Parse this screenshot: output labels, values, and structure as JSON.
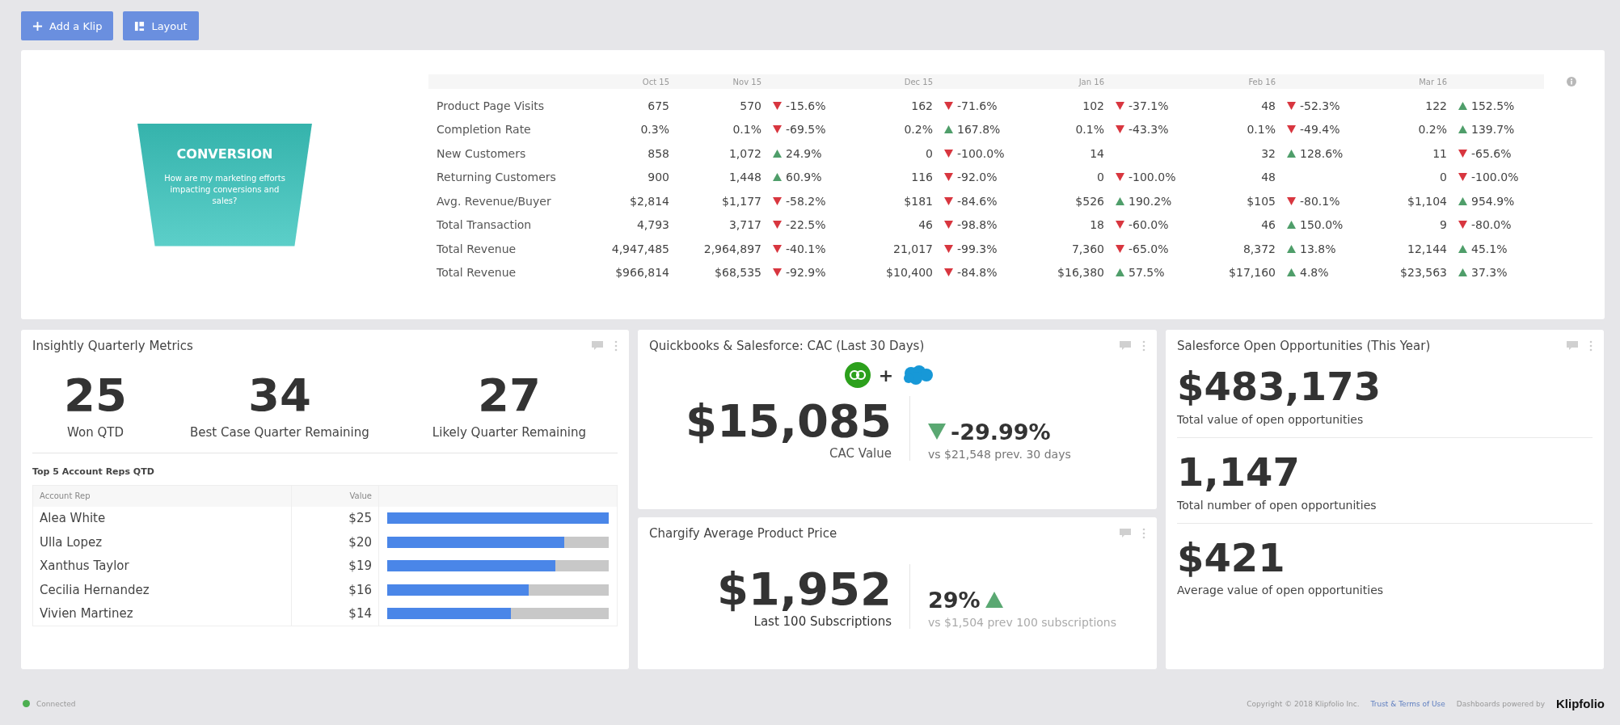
{
  "toolbar": {
    "buttons": [
      {
        "kind": "add",
        "label": "Add a Klip"
      },
      {
        "kind": "layout",
        "label": "Layout"
      }
    ]
  },
  "conversion": {
    "title": "CONVERSION",
    "description": "How are my marketing efforts impacting conversions and sales?"
  },
  "metrics_table": {
    "columns": [
      "Oct 15",
      "Nov 15",
      "Dec 15",
      "Jan 16",
      "Feb 16",
      "Mar 16"
    ],
    "rows": [
      {
        "label": "Product Page Visits",
        "cells": [
          {
            "value": "675"
          },
          {
            "value": "570",
            "change": "-15.6%",
            "up": false
          },
          {
            "value": "162",
            "change": "-71.6%",
            "up": false
          },
          {
            "value": "102",
            "change": "-37.1%",
            "up": false
          },
          {
            "value": "48",
            "change": "-52.3%",
            "up": false
          },
          {
            "value": "122",
            "change": "152.5%",
            "up": true
          }
        ]
      },
      {
        "label": "Completion Rate",
        "cells": [
          {
            "value": "0.3%"
          },
          {
            "value": "0.1%",
            "change": "-69.5%",
            "up": false
          },
          {
            "value": "0.2%",
            "change": "167.8%",
            "up": true
          },
          {
            "value": "0.1%",
            "change": "-43.3%",
            "up": false
          },
          {
            "value": "0.1%",
            "change": "-49.4%",
            "up": false
          },
          {
            "value": "0.2%",
            "change": "139.7%",
            "up": true
          }
        ]
      },
      {
        "label": "New Customers",
        "cells": [
          {
            "value": "858"
          },
          {
            "value": "1,072",
            "change": "24.9%",
            "up": true
          },
          {
            "value": "0",
            "change": "-100.0%",
            "up": false
          },
          {
            "value": "14"
          },
          {
            "value": "32",
            "change": "128.6%",
            "up": true
          },
          {
            "value": "11",
            "change": "-65.6%",
            "up": false
          }
        ]
      },
      {
        "label": "Returning Customers",
        "cells": [
          {
            "value": "900"
          },
          {
            "value": "1,448",
            "change": "60.9%",
            "up": true
          },
          {
            "value": "116",
            "change": "-92.0%",
            "up": false
          },
          {
            "value": "0",
            "change": "-100.0%",
            "up": false
          },
          {
            "value": "48"
          },
          {
            "value": "0",
            "change": "-100.0%",
            "up": false
          }
        ]
      },
      {
        "label": "Avg. Revenue/Buyer",
        "cells": [
          {
            "value": "$2,814"
          },
          {
            "value": "$1,177",
            "change": "-58.2%",
            "up": false
          },
          {
            "value": "$181",
            "change": "-84.6%",
            "up": false
          },
          {
            "value": "$526",
            "change": "190.2%",
            "up": true
          },
          {
            "value": "$105",
            "change": "-80.1%",
            "up": false
          },
          {
            "value": "$1,104",
            "change": "954.9%",
            "up": true
          }
        ]
      },
      {
        "label": "Total Transaction",
        "cells": [
          {
            "value": "4,793"
          },
          {
            "value": "3,717",
            "change": "-22.5%",
            "up": false
          },
          {
            "value": "46",
            "change": "-98.8%",
            "up": false
          },
          {
            "value": "18",
            "change": "-60.0%",
            "up": false
          },
          {
            "value": "46",
            "change": "150.0%",
            "up": true
          },
          {
            "value": "9",
            "change": "-80.0%",
            "up": false
          }
        ]
      },
      {
        "label": "Total Revenue",
        "cells": [
          {
            "value": "4,947,485"
          },
          {
            "value": "2,964,897",
            "change": "-40.1%",
            "up": false
          },
          {
            "value": "21,017",
            "change": "-99.3%",
            "up": false
          },
          {
            "value": "7,360",
            "change": "-65.0%",
            "up": false
          },
          {
            "value": "8,372",
            "change": "13.8%",
            "up": true
          },
          {
            "value": "12,144",
            "change": "45.1%",
            "up": true
          }
        ]
      },
      {
        "label": "Total Revenue",
        "cells": [
          {
            "value": "$966,814"
          },
          {
            "value": "$68,535",
            "change": "-92.9%",
            "up": false
          },
          {
            "value": "$10,400",
            "change": "-84.8%",
            "up": false
          },
          {
            "value": "$16,380",
            "change": "57.5%",
            "up": true
          },
          {
            "value": "$17,160",
            "change": "4.8%",
            "up": true
          },
          {
            "value": "$23,563",
            "change": "37.3%",
            "up": true
          }
        ]
      }
    ]
  },
  "insightly": {
    "title": "Insightly Quarterly Metrics",
    "kpis": [
      {
        "value": "25",
        "label": "Won QTD"
      },
      {
        "value": "34",
        "label": "Best Case Quarter Remaining"
      },
      {
        "value": "27",
        "label": "Likely Quarter Remaining"
      }
    ],
    "reps_title": "Top 5 Account Reps QTD",
    "columns": [
      "Account Rep",
      "Value"
    ],
    "reps": [
      {
        "name": "Alea White",
        "value": "$25",
        "level": 1
      },
      {
        "name": "Ulla Lopez",
        "value": "$20",
        "level": 0.8
      },
      {
        "name": "Xanthus Taylor",
        "value": "$19",
        "level": 0.76
      },
      {
        "name": "Cecilia Hernandez",
        "value": "$16",
        "level": 0.64
      },
      {
        "name": "Vivien Martinez",
        "value": "$14",
        "level": 0.56
      }
    ]
  },
  "cac": {
    "title": "Quickbooks & Salesforce: CAC (Last 30 Days)",
    "plus": "+",
    "value": "$15,085",
    "label": "CAC Value",
    "change": "-29.99%",
    "up": false,
    "comparison": "vs $21,548 prev. 30 days"
  },
  "price": {
    "title": "Chargify Average Product Price",
    "value": "$1,952",
    "label": "Last 100 Subscriptions",
    "change": "29%",
    "up": true,
    "comparison": "vs $1,504 prev 100 subscriptions"
  },
  "opportunities": {
    "title": "Salesforce Open Opportunities (This Year)",
    "metrics": [
      {
        "value": "$483,173",
        "label": "Total value of open opportunities"
      },
      {
        "value": "1,147",
        "label": "Total number of open opportunities"
      },
      {
        "value": "$421",
        "label": "Average value of open opportunities"
      }
    ]
  },
  "footer": {
    "status": "Connected",
    "copyright": "Copyright © 2018 Klipfolio Inc.",
    "terms_link": "Trust & Terms of Use",
    "powered_by": "Dashboards powered by",
    "brand": "Klipfolio"
  }
}
